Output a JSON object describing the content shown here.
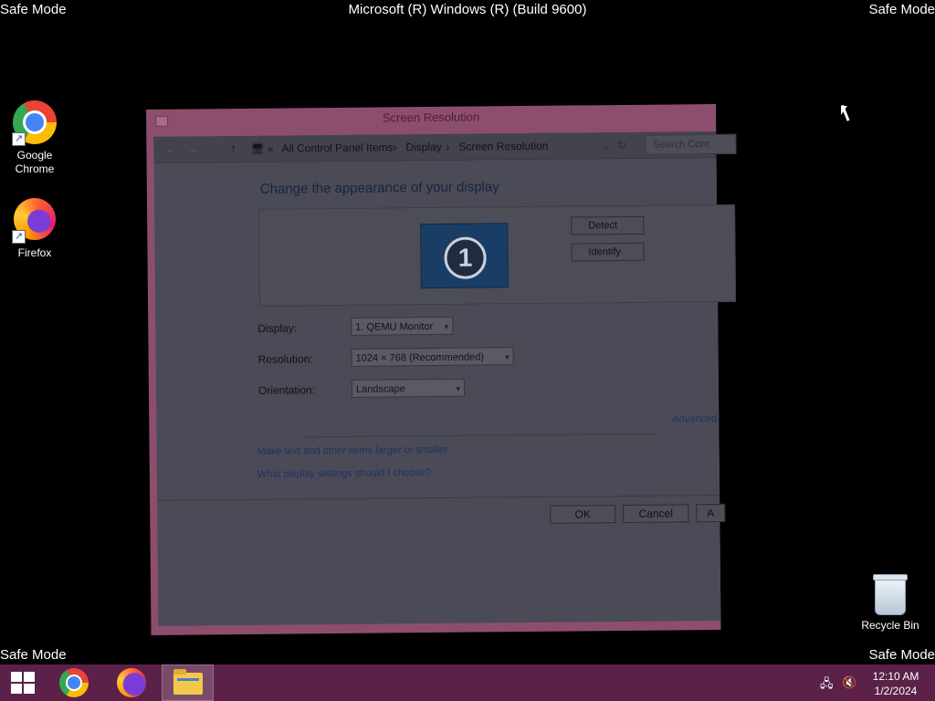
{
  "watermark": {
    "top_left": "Safe Mode",
    "top_right": "Safe Mode",
    "bottom_left": "Safe Mode",
    "bottom_right": "Safe Mode",
    "center": "Microsoft (R) Windows (R) (Build 9600)"
  },
  "desktop": {
    "icons": [
      {
        "label": "Google\nChrome",
        "icon": "chrome-icon"
      },
      {
        "label": "Firefox",
        "icon": "firefox-icon"
      }
    ],
    "recycle_bin": "Recycle Bin"
  },
  "window": {
    "title": "Screen Resolution",
    "breadcrumb": [
      "All Control Panel Items",
      "Display",
      "Screen Resolution"
    ],
    "search_placeholder": "Search Cont",
    "heading": "Change the appearance of your display",
    "monitor_number": "1",
    "detect_label": "Detect",
    "identify_label": "Identify",
    "display_label": "Display:",
    "display_value": "1. QEMU Monitor",
    "resolution_label": "Resolution:",
    "resolution_value": "1024 × 768 (Recommended)",
    "orientation_label": "Orientation:",
    "orientation_value": "Landscape",
    "advanced_link": "Advanced",
    "link_text_size": "Make text and other items larger or smaller",
    "link_display_settings": "What display settings should I choose?",
    "ok_label": "OK",
    "cancel_label": "Cancel",
    "apply_label": "A"
  },
  "taskbar": {
    "clock_time": "12:10 AM",
    "clock_date": "1/2/2024"
  },
  "colors": {
    "taskbar": "#5b2148",
    "window_frame": "#8d4e6e",
    "window_body": "#4b4b57"
  }
}
